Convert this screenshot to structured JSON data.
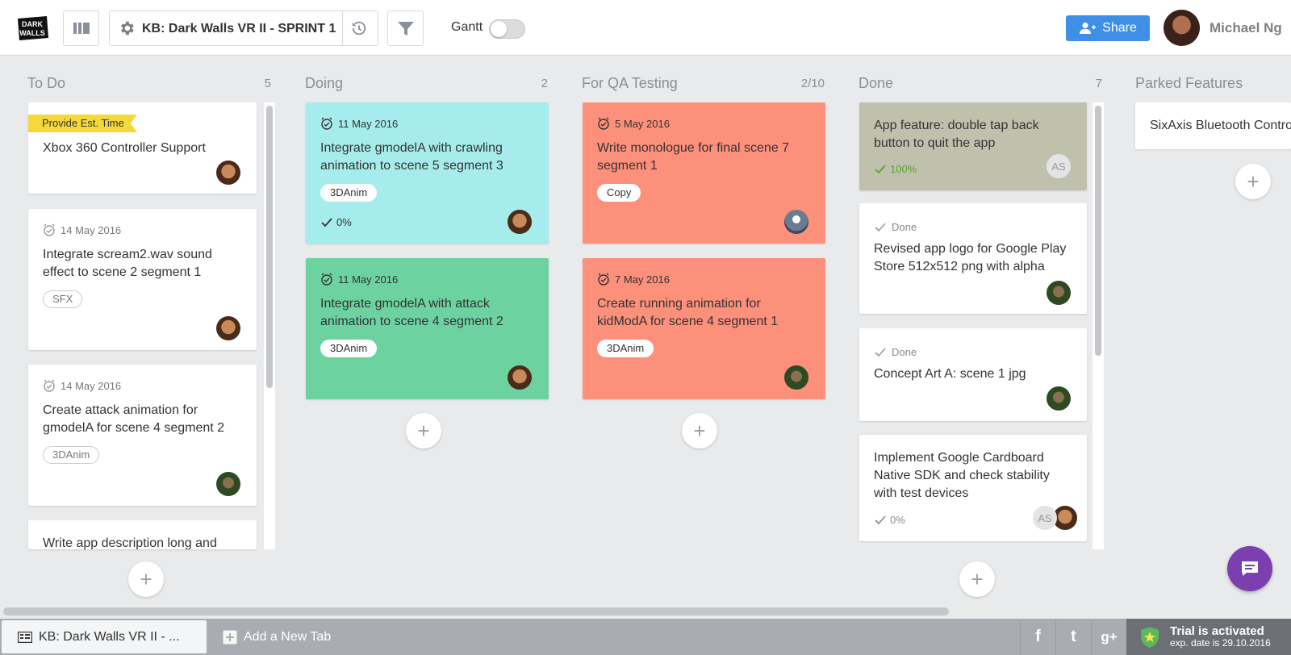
{
  "header": {
    "board_title": "KB: Dark Walls VR II - SPRINT 1",
    "logo_text": "DARK WALLS",
    "gantt_label": "Gantt",
    "share_label": "Share",
    "user_name": "Michael Ng"
  },
  "columns": [
    {
      "name": "To Do",
      "count": "5"
    },
    {
      "name": "Doing",
      "count": "2"
    },
    {
      "name": "For QA Testing",
      "count": "2/10"
    },
    {
      "name": "Done",
      "count": "7"
    },
    {
      "name": "Parked Features",
      "count": ""
    }
  ],
  "todo": [
    {
      "ribbon": "Provide Est. Time",
      "title": "Xbox 360 Controller Support"
    },
    {
      "date": "14 May 2016",
      "title": "Integrate scream2.wav sound effect to scene 2 segment 1",
      "tag": "SFX"
    },
    {
      "date": "14 May 2016",
      "title": "Create attack animation for gmodelA for scene 4 segment 2",
      "tag": "3DAnim"
    },
    {
      "title": "Write app description long and"
    }
  ],
  "doing": [
    {
      "date": "11 May 2016",
      "title": "Integrate gmodelA with crawling animation to scene 5 segment 3",
      "tag": "3DAnim",
      "progress": "0%"
    },
    {
      "date": "11 May 2016",
      "title": "Integrate gmodelA with attack animation to scene 4 segment 2",
      "tag": "3DAnim"
    }
  ],
  "qa": [
    {
      "date": "5 May 2016",
      "title": "Write monologue for final scene 7 segment 1",
      "tag": "Copy"
    },
    {
      "date": "7 May 2016",
      "title": "Create running animation for kidModA for scene 4 segment 1",
      "tag": "3DAnim"
    }
  ],
  "done": [
    {
      "title": "App feature: double tap back button to quit the app",
      "progress": "100%",
      "initials": "AS"
    },
    {
      "status": "Done",
      "title": "Revised app logo for Google Play Store 512x512 png with alpha"
    },
    {
      "status": "Done",
      "title": "Concept Art A: scene 1 jpg"
    },
    {
      "title": "Implement Google Cardboard Native SDK and check stability with test devices",
      "progress": "0%",
      "initials": "AS"
    }
  ],
  "parked": [
    {
      "title": "SixAxis Bluetooth Contro"
    }
  ],
  "add_symbol": "+",
  "bottom": {
    "tab_label": "KB: Dark Walls VR II - ...",
    "new_tab_label": "Add a New Tab",
    "social": [
      "f",
      "t",
      "g+"
    ],
    "trial_title": "Trial is activated",
    "trial_sub": "exp. date is 29.10.2016"
  },
  "colors": {
    "cyan_card": "#a6ecec",
    "green_card": "#6cd3a0",
    "salmon_card": "#fd907b",
    "olive_card": "#c0c1ad",
    "share_blue": "#3f8fe6",
    "chat_purple": "#7b3fb0",
    "ribbon_yellow": "#f5d93b"
  },
  "icons": [
    "board-icon",
    "gear-icon",
    "history-icon",
    "filter-icon",
    "share-user-icon",
    "clock-icon",
    "check-icon",
    "chat-icon",
    "tab-icon",
    "add-tab-icon",
    "shield-star-icon"
  ]
}
